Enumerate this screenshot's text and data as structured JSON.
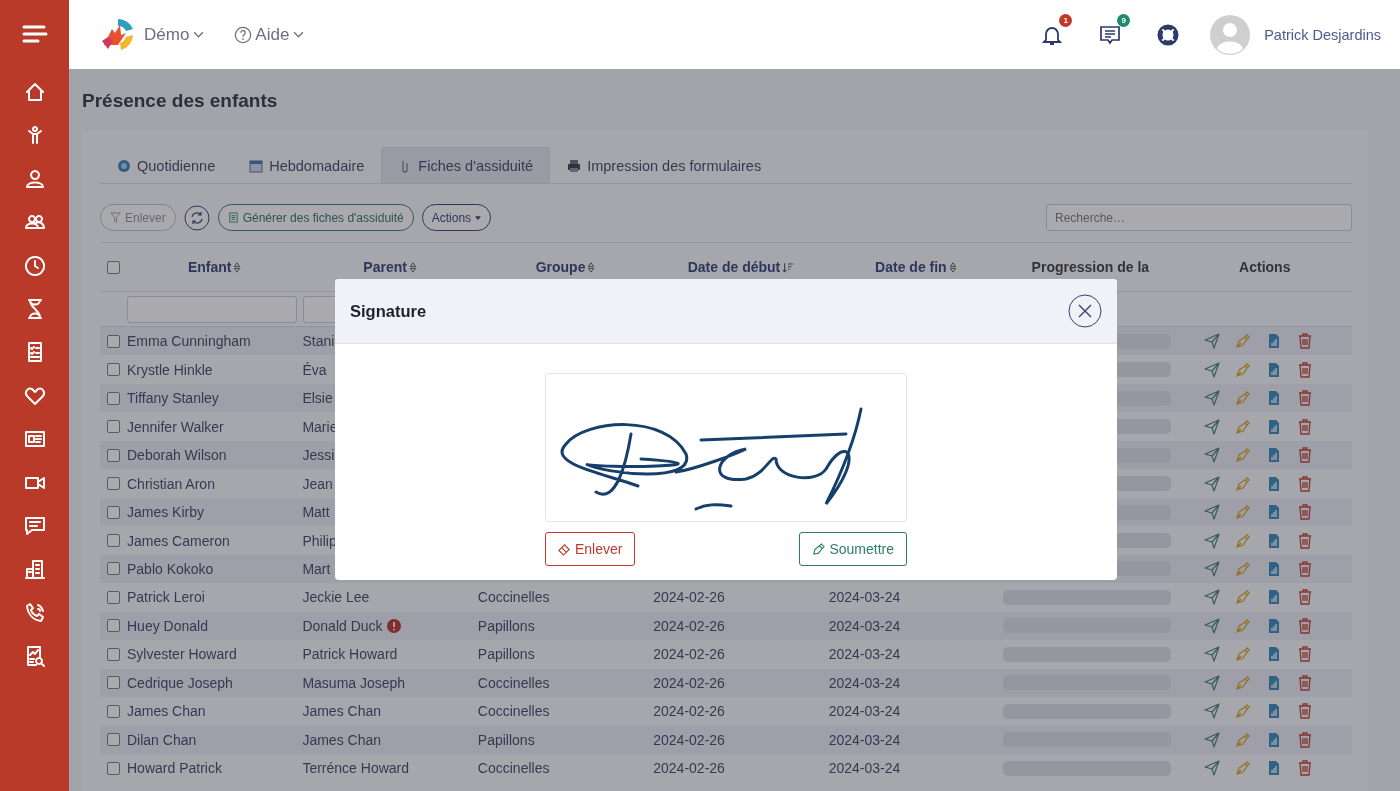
{
  "topbar": {
    "brand": "Démo",
    "help": "Aide",
    "notifications": "1",
    "messages": "9",
    "user": "Patrick Desjardins"
  },
  "page_title": "Présence des enfants",
  "tabs": [
    {
      "label": "Quotidienne",
      "selected": false
    },
    {
      "label": "Hebdomadaire",
      "selected": false
    },
    {
      "label": "Fiches d'assiduité",
      "selected": true
    },
    {
      "label": "Impression des formulaires",
      "selected": false
    }
  ],
  "toolbar": {
    "clear": "Enlever",
    "generate": "Générer des fiches d'assiduité",
    "actions": "Actions",
    "search_placeholder": "Recherche…"
  },
  "table": {
    "select_all_checked": false,
    "columns": [
      {
        "label": "Enfant",
        "sortable": true,
        "sorted_desc": false
      },
      {
        "label": "Parent",
        "sortable": true,
        "sorted_desc": false
      },
      {
        "label": "Groupe",
        "sortable": true,
        "sorted_desc": false
      },
      {
        "label": "Date de début",
        "sortable": true,
        "sorted_desc": true
      },
      {
        "label": "Date de fin",
        "sortable": true,
        "sorted_desc": false
      },
      {
        "label": "Progression de la",
        "sortable": false
      },
      {
        "label": "Actions",
        "sortable": false
      }
    ],
    "rows": [
      {
        "child": "Emma Cunningham",
        "parent": "Stani",
        "checked": false,
        "warning": false,
        "level": 0
      },
      {
        "child": "Krystle Hinkle",
        "parent": "Éva",
        "checked": false,
        "warning": false,
        "level": 0
      },
      {
        "child": "Tiffany Stanley",
        "parent": "Elsie",
        "checked": false,
        "warning": false,
        "level": 0
      },
      {
        "child": "Jennifer Walker",
        "parent": "Marie",
        "checked": false,
        "warning": false,
        "level": 0
      },
      {
        "child": "Deborah Wilson",
        "parent": "Jessi",
        "checked": false,
        "warning": false,
        "level": 0
      },
      {
        "child": "Christian Aron",
        "parent": "Jean",
        "checked": false,
        "warning": false,
        "level": 0
      },
      {
        "child": "James Kirby",
        "parent": "Matt",
        "checked": false,
        "warning": false,
        "level": 0
      },
      {
        "child": "James Cameron",
        "parent": "Philip",
        "checked": false,
        "warning": false,
        "level": 0
      },
      {
        "child": "Pablo Kokoko",
        "parent": "Mart",
        "checked": false,
        "warning": false,
        "level": 0
      },
      {
        "child": "Patrick Leroi",
        "parent": "Jeckie Lee",
        "group": "Coccinelles",
        "start": "2024-02-26",
        "end": "2024-03-24",
        "checked": false,
        "warning": false,
        "level": 0
      },
      {
        "child": "Huey Donald",
        "parent": "Donald Duck",
        "group": "Papillons",
        "start": "2024-02-26",
        "end": "2024-03-24",
        "checked": false,
        "warning": true,
        "level": 0
      },
      {
        "child": "Sylvester Howard",
        "parent": "Patrick Howard",
        "group": "Papillons",
        "start": "2024-02-26",
        "end": "2024-03-24",
        "checked": false,
        "warning": false,
        "level": 0
      },
      {
        "child": "Cedrique Joseph",
        "parent": "Masuma Joseph",
        "group": "Coccinelles",
        "start": "2024-02-26",
        "end": "2024-03-24",
        "checked": false,
        "warning": false,
        "level": 0
      },
      {
        "child": "James Chan",
        "parent": "James Chan",
        "group": "Coccinelles",
        "start": "2024-02-26",
        "end": "2024-03-24",
        "checked": false,
        "warning": false,
        "level": 0
      },
      {
        "child": "Dilan Chan",
        "parent": "James Chan",
        "group": "Papillons",
        "start": "2024-02-26",
        "end": "2024-03-24",
        "checked": false,
        "warning": false,
        "level": 0
      },
      {
        "child": "Howard Patrick",
        "parent": "Terrénce Howard",
        "group": "Coccinelles",
        "start": "2024-02-26",
        "end": "2024-03-24",
        "checked": false,
        "warning": false,
        "level": 0
      }
    ]
  },
  "modal": {
    "title": "Signature",
    "clear": "Enlever",
    "submit": "Soumettre"
  }
}
